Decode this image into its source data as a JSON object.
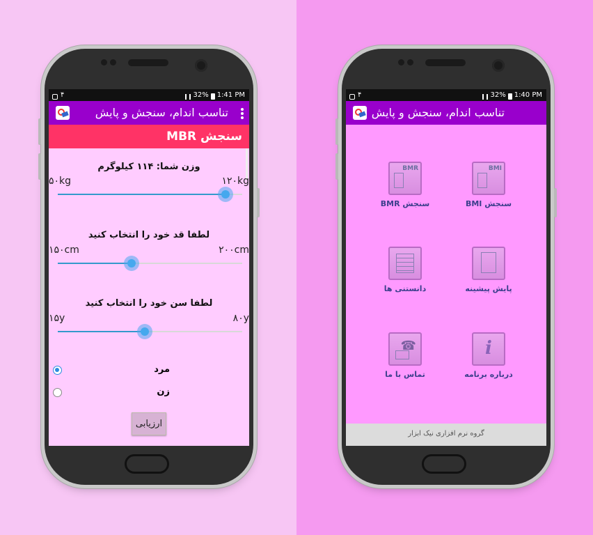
{
  "left_screen": {
    "status": {
      "left": "۴",
      "right": "32%",
      "time": "1:41 PM"
    },
    "appbar": {
      "title": "تناسب اندام، سنجش و پایش"
    },
    "section_title": "سنجش MBR",
    "weight": {
      "label": "وزن شما: ۱۱۴ کیلوگرم",
      "min": "۵۰kg",
      "max": "۱۲۰kg",
      "level": 0.91
    },
    "height": {
      "label": "لطفا قد خود را انتخاب کنید",
      "min": "۱۵۰cm",
      "max": "۲۰۰cm",
      "level": 0.4
    },
    "age": {
      "label": "لطفا سن خود را انتخاب کنید",
      "min": "۱۵y",
      "max": "۸۰y",
      "level": 0.47
    },
    "gender": [
      {
        "label": "مرد",
        "selected": true
      },
      {
        "label": "زن",
        "selected": false
      }
    ],
    "evaluate_button": "ارزیابی"
  },
  "right_screen": {
    "status": {
      "left": "۴",
      "right": "32%",
      "time": "1:40 PM"
    },
    "appbar": {
      "title": "تناسب اندام، سنجش و پایش"
    },
    "tiles": [
      {
        "label": "سنجش BMI",
        "icon": "bmi-icon",
        "tag": "BMI"
      },
      {
        "label": "سنجش BMR",
        "icon": "bmr-icon",
        "tag": "BMR"
      },
      {
        "label": "پایش پیشینه",
        "icon": "clipboard-icon"
      },
      {
        "label": "دانستنی ها",
        "icon": "notes-icon"
      },
      {
        "label": "درباره برنامه",
        "icon": "info-icon"
      },
      {
        "label": "تماس با ما",
        "icon": "contact-icon"
      }
    ],
    "footer": "گروه نرم افزاری نیک ابزار"
  }
}
